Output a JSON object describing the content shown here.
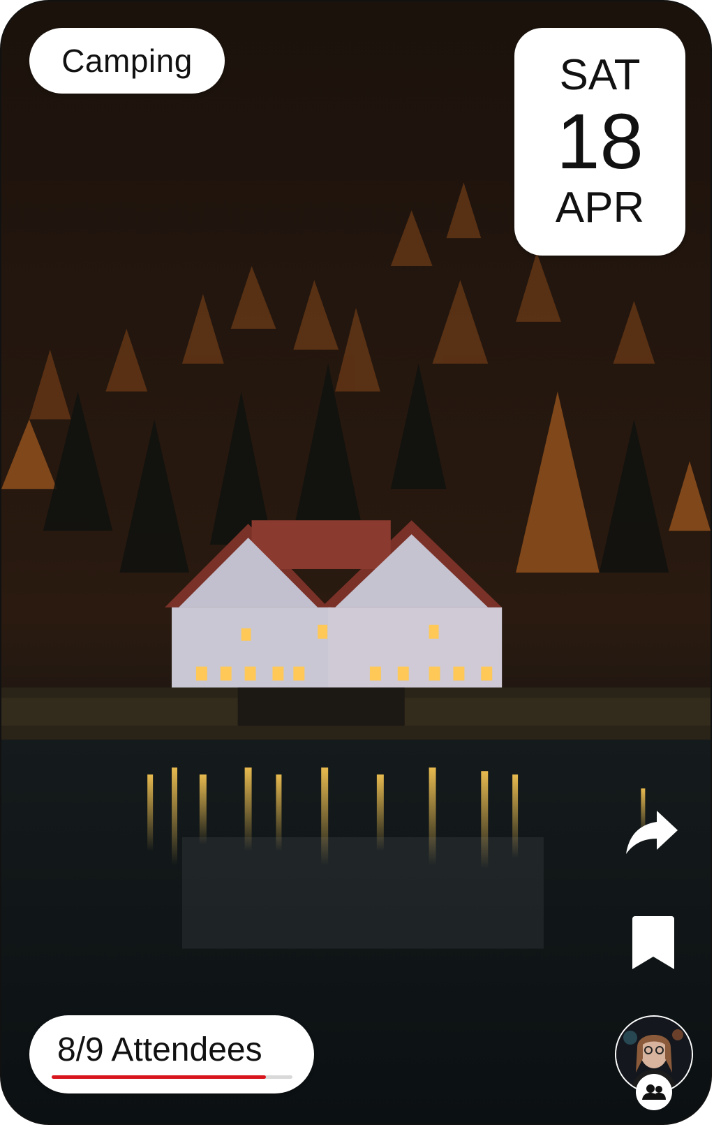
{
  "event": {
    "category": "Camping",
    "date": {
      "day": "SAT",
      "number": "18",
      "month": "APR"
    },
    "attendees": {
      "label": "8/9 Attendees",
      "current": 8,
      "capacity": 9,
      "progress_fraction": 0.889
    },
    "scene": "lakeside-house-forest-night"
  },
  "actions": {
    "share": {
      "icon": "share-icon"
    },
    "bookmark": {
      "icon": "bookmark-icon"
    },
    "host": {
      "icon": "avatar",
      "badge_icon": "group-icon"
    }
  },
  "colors": {
    "progress": "#d8141c",
    "chip_bg": "#ffffff",
    "text": "#111111"
  }
}
